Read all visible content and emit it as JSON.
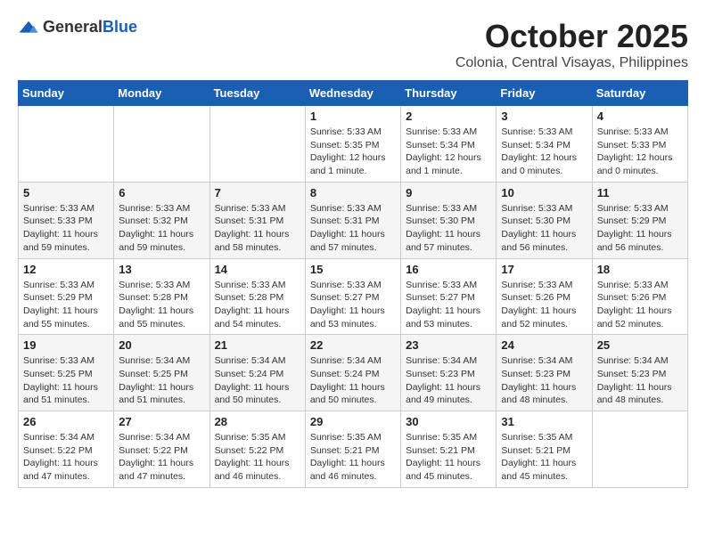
{
  "header": {
    "logo_general": "General",
    "logo_blue": "Blue",
    "month": "October 2025",
    "location": "Colonia, Central Visayas, Philippines"
  },
  "weekdays": [
    "Sunday",
    "Monday",
    "Tuesday",
    "Wednesday",
    "Thursday",
    "Friday",
    "Saturday"
  ],
  "weeks": [
    [
      {
        "day": "",
        "info": ""
      },
      {
        "day": "",
        "info": ""
      },
      {
        "day": "",
        "info": ""
      },
      {
        "day": "1",
        "info": "Sunrise: 5:33 AM\nSunset: 5:35 PM\nDaylight: 12 hours\nand 1 minute."
      },
      {
        "day": "2",
        "info": "Sunrise: 5:33 AM\nSunset: 5:34 PM\nDaylight: 12 hours\nand 1 minute."
      },
      {
        "day": "3",
        "info": "Sunrise: 5:33 AM\nSunset: 5:34 PM\nDaylight: 12 hours\nand 0 minutes."
      },
      {
        "day": "4",
        "info": "Sunrise: 5:33 AM\nSunset: 5:33 PM\nDaylight: 12 hours\nand 0 minutes."
      }
    ],
    [
      {
        "day": "5",
        "info": "Sunrise: 5:33 AM\nSunset: 5:33 PM\nDaylight: 11 hours\nand 59 minutes."
      },
      {
        "day": "6",
        "info": "Sunrise: 5:33 AM\nSunset: 5:32 PM\nDaylight: 11 hours\nand 59 minutes."
      },
      {
        "day": "7",
        "info": "Sunrise: 5:33 AM\nSunset: 5:31 PM\nDaylight: 11 hours\nand 58 minutes."
      },
      {
        "day": "8",
        "info": "Sunrise: 5:33 AM\nSunset: 5:31 PM\nDaylight: 11 hours\nand 57 minutes."
      },
      {
        "day": "9",
        "info": "Sunrise: 5:33 AM\nSunset: 5:30 PM\nDaylight: 11 hours\nand 57 minutes."
      },
      {
        "day": "10",
        "info": "Sunrise: 5:33 AM\nSunset: 5:30 PM\nDaylight: 11 hours\nand 56 minutes."
      },
      {
        "day": "11",
        "info": "Sunrise: 5:33 AM\nSunset: 5:29 PM\nDaylight: 11 hours\nand 56 minutes."
      }
    ],
    [
      {
        "day": "12",
        "info": "Sunrise: 5:33 AM\nSunset: 5:29 PM\nDaylight: 11 hours\nand 55 minutes."
      },
      {
        "day": "13",
        "info": "Sunrise: 5:33 AM\nSunset: 5:28 PM\nDaylight: 11 hours\nand 55 minutes."
      },
      {
        "day": "14",
        "info": "Sunrise: 5:33 AM\nSunset: 5:28 PM\nDaylight: 11 hours\nand 54 minutes."
      },
      {
        "day": "15",
        "info": "Sunrise: 5:33 AM\nSunset: 5:27 PM\nDaylight: 11 hours\nand 53 minutes."
      },
      {
        "day": "16",
        "info": "Sunrise: 5:33 AM\nSunset: 5:27 PM\nDaylight: 11 hours\nand 53 minutes."
      },
      {
        "day": "17",
        "info": "Sunrise: 5:33 AM\nSunset: 5:26 PM\nDaylight: 11 hours\nand 52 minutes."
      },
      {
        "day": "18",
        "info": "Sunrise: 5:33 AM\nSunset: 5:26 PM\nDaylight: 11 hours\nand 52 minutes."
      }
    ],
    [
      {
        "day": "19",
        "info": "Sunrise: 5:33 AM\nSunset: 5:25 PM\nDaylight: 11 hours\nand 51 minutes."
      },
      {
        "day": "20",
        "info": "Sunrise: 5:34 AM\nSunset: 5:25 PM\nDaylight: 11 hours\nand 51 minutes."
      },
      {
        "day": "21",
        "info": "Sunrise: 5:34 AM\nSunset: 5:24 PM\nDaylight: 11 hours\nand 50 minutes."
      },
      {
        "day": "22",
        "info": "Sunrise: 5:34 AM\nSunset: 5:24 PM\nDaylight: 11 hours\nand 50 minutes."
      },
      {
        "day": "23",
        "info": "Sunrise: 5:34 AM\nSunset: 5:23 PM\nDaylight: 11 hours\nand 49 minutes."
      },
      {
        "day": "24",
        "info": "Sunrise: 5:34 AM\nSunset: 5:23 PM\nDaylight: 11 hours\nand 48 minutes."
      },
      {
        "day": "25",
        "info": "Sunrise: 5:34 AM\nSunset: 5:23 PM\nDaylight: 11 hours\nand 48 minutes."
      }
    ],
    [
      {
        "day": "26",
        "info": "Sunrise: 5:34 AM\nSunset: 5:22 PM\nDaylight: 11 hours\nand 47 minutes."
      },
      {
        "day": "27",
        "info": "Sunrise: 5:34 AM\nSunset: 5:22 PM\nDaylight: 11 hours\nand 47 minutes."
      },
      {
        "day": "28",
        "info": "Sunrise: 5:35 AM\nSunset: 5:22 PM\nDaylight: 11 hours\nand 46 minutes."
      },
      {
        "day": "29",
        "info": "Sunrise: 5:35 AM\nSunset: 5:21 PM\nDaylight: 11 hours\nand 46 minutes."
      },
      {
        "day": "30",
        "info": "Sunrise: 5:35 AM\nSunset: 5:21 PM\nDaylight: 11 hours\nand 45 minutes."
      },
      {
        "day": "31",
        "info": "Sunrise: 5:35 AM\nSunset: 5:21 PM\nDaylight: 11 hours\nand 45 minutes."
      },
      {
        "day": "",
        "info": ""
      }
    ]
  ]
}
